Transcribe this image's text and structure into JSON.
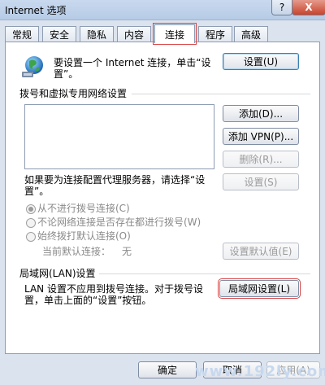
{
  "window": {
    "title": "Internet 选项",
    "help_label": "?",
    "close_label": "X"
  },
  "tabs": [
    {
      "label": "常规"
    },
    {
      "label": "安全"
    },
    {
      "label": "隐私"
    },
    {
      "label": "内容"
    },
    {
      "label": "连接",
      "active": true
    },
    {
      "label": "程序"
    },
    {
      "label": "高级"
    }
  ],
  "setup": {
    "text_line1": "要设置一个 Internet 连接，单击“设",
    "text_line2": "置”。",
    "button": "设置(U)"
  },
  "dialup": {
    "heading": "拨号和虚拟专用网络设置",
    "add_button": "添加(D)...",
    "add_vpn_button": "添加 VPN(P)...",
    "remove_button": "删除(R)...",
    "proxy_text_line1": "如果要为连接配置代理服务器，请选择“设",
    "proxy_text_line2": "置”。",
    "settings_button": "设置(S)",
    "options": [
      {
        "label": "从不进行拨号连接(C)",
        "checked": true
      },
      {
        "label": "不论网络连接是否存在都进行拨号(W)",
        "checked": false
      },
      {
        "label": "始终拨打默认连接(O)",
        "checked": false
      }
    ],
    "current_default_label": "当前默认连接：",
    "current_default_value": "无",
    "set_default_button": "设置默认值(E)"
  },
  "lan": {
    "heading": "局域网(LAN)设置",
    "text_line1": "LAN 设置不应用到拨号连接。对于拨号设",
    "text_line2": "置，单击上面的“设置”按钮。",
    "button": "局域网设置(L)"
  },
  "footer": {
    "ok": "确定",
    "cancel": "取消",
    "apply": "应用(A)"
  },
  "watermark": "www.192ly.com",
  "colors": {
    "highlight": "#d84545",
    "titlebar": "#c9d9ee"
  }
}
